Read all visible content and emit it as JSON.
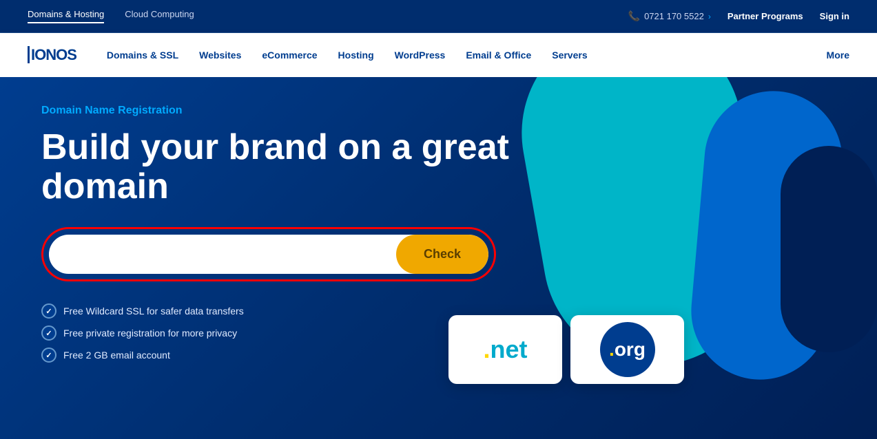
{
  "topbar": {
    "nav_items": [
      {
        "label": "Domains & Hosting",
        "active": true
      },
      {
        "label": "Cloud Computing",
        "active": false
      }
    ],
    "phone": "0721 170 5522",
    "partner_programs": "Partner Programs",
    "sign_in": "Sign in"
  },
  "mainnav": {
    "logo": "IONOS",
    "items": [
      {
        "label": "Domains & SSL"
      },
      {
        "label": "Websites"
      },
      {
        "label": "eCommerce"
      },
      {
        "label": "Hosting"
      },
      {
        "label": "WordPress"
      },
      {
        "label": "Email & Office"
      },
      {
        "label": "Servers"
      }
    ],
    "more": "More"
  },
  "hero": {
    "subtitle": "Domain Name Registration",
    "headline_line1": "Build your brand on a great",
    "headline_line2": "domain",
    "search_placeholder": "",
    "check_button": "Check",
    "features": [
      "Free Wildcard SSL for safer data transfers",
      "Free private registration for more privacy",
      "Free 2 GB email account"
    ],
    "domain_badges": [
      {
        "label": ".net",
        "type": "net"
      },
      {
        "label": ".org",
        "type": "org"
      }
    ]
  }
}
